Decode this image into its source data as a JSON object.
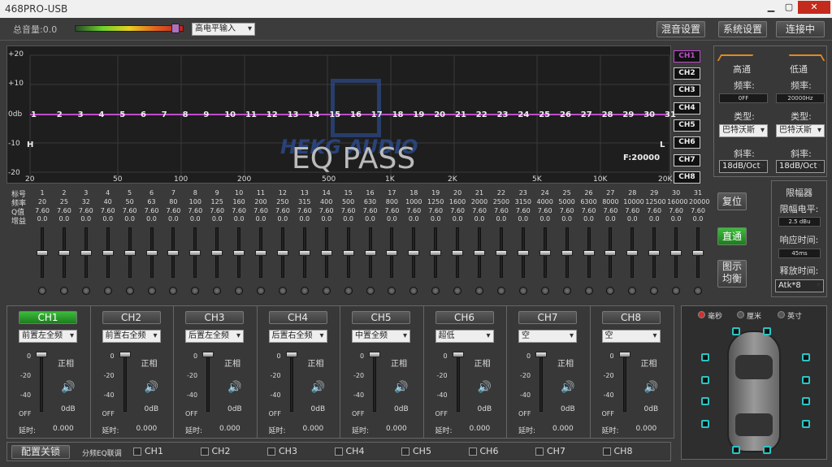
{
  "window": {
    "title": "468PRO-USB",
    "min": "▁",
    "max": "▢",
    "close": "✕"
  },
  "toolbar": {
    "master_volume": "总音量:0.0",
    "input_mode": "高电平输入",
    "mix_settings": "混音设置",
    "system_settings": "系统设置",
    "connect": "连接中"
  },
  "graph": {
    "y_labels": [
      "+20",
      "+10",
      "0db",
      "-10",
      "-20"
    ],
    "x_labels": [
      "20",
      "50",
      "100",
      "200",
      "500",
      "1K",
      "2K",
      "5K",
      "10K",
      "20K"
    ],
    "band_numbers": [
      "1",
      "2",
      "3",
      "4",
      "5",
      "6",
      "7",
      "8",
      "9",
      "10",
      "11",
      "12",
      "13",
      "14",
      "15",
      "16",
      "17",
      "18",
      "19",
      "20",
      "21",
      "22",
      "23",
      "24",
      "25",
      "26",
      "27",
      "28",
      "29",
      "30",
      "31"
    ],
    "h_mark": "H",
    "l_mark": "L",
    "freq_readout": "F:20000",
    "logo_text": "HEKG AUDIO",
    "eq_status": "EQ PASS",
    "channels": [
      "CH1",
      "CH2",
      "CH3",
      "CH4",
      "CH5",
      "CH6",
      "CH7",
      "CH8"
    ]
  },
  "eq": {
    "row_labels": [
      "标号",
      "频率",
      "Q值",
      "增益"
    ],
    "freqs": [
      "20",
      "25",
      "32",
      "40",
      "50",
      "63",
      "80",
      "100",
      "125",
      "160",
      "200",
      "250",
      "315",
      "400",
      "500",
      "630",
      "800",
      "1000",
      "1250",
      "1600",
      "2000",
      "2500",
      "3150",
      "4000",
      "5000",
      "6300",
      "8000",
      "10000",
      "12500",
      "16000",
      "20000"
    ],
    "q": "7.60",
    "gain": "0.0",
    "reset": "复位",
    "bypass": "直通",
    "show_eq": "图示\n均衡"
  },
  "crossover": {
    "hp": {
      "title": "高通",
      "freq_label": "频率:",
      "freq": "0FF",
      "type_label": "类型:",
      "type": "巴特沃斯",
      "slope_label": "斜率:",
      "slope": "18dB/Oct"
    },
    "lp": {
      "title": "低通",
      "freq_label": "频率:",
      "freq": "20000Hz",
      "type_label": "类型:",
      "type": "巴特沃斯",
      "slope_label": "斜率:",
      "slope": "18dB/Oct"
    }
  },
  "limiter": {
    "title": "限幅器",
    "level_label": "限幅电平:",
    "level": "2.5 dBu",
    "attack_label": "响应时间:",
    "attack": "45ms",
    "release_label": "释放时间:",
    "release": "Atk*8"
  },
  "channels": [
    {
      "name": "CH1",
      "pos": "前置左全频",
      "phase": "正相",
      "gain": "0dB",
      "delay_label": "延时:",
      "delay": "0.000"
    },
    {
      "name": "CH2",
      "pos": "前置右全频",
      "phase": "正相",
      "gain": "0dB",
      "delay_label": "延时:",
      "delay": "0.000"
    },
    {
      "name": "CH3",
      "pos": "后置左全频",
      "phase": "正相",
      "gain": "0dB",
      "delay_label": "延时:",
      "delay": "0.000"
    },
    {
      "name": "CH4",
      "pos": "后置右全频",
      "phase": "正相",
      "gain": "0dB",
      "delay_label": "延时:",
      "delay": "0.000"
    },
    {
      "name": "CH5",
      "pos": "中置全频",
      "phase": "正相",
      "gain": "0dB",
      "delay_label": "延时:",
      "delay": "0.000"
    },
    {
      "name": "CH6",
      "pos": "超低",
      "phase": "正相",
      "gain": "0dB",
      "delay_label": "延时:",
      "delay": "0.000"
    },
    {
      "name": "CH7",
      "pos": "空",
      "phase": "正相",
      "gain": "0dB",
      "delay_label": "延时:",
      "delay": "0.000"
    },
    {
      "name": "CH8",
      "pos": "空",
      "phase": "正相",
      "gain": "0dB",
      "delay_label": "延时:",
      "delay": "0.000"
    }
  ],
  "fader_scale": [
    "0",
    "-20",
    "-40",
    "OFF"
  ],
  "units": {
    "ms": "毫秒",
    "cm": "厘米",
    "inch": "英寸"
  },
  "bottom": {
    "config_lock": "配置关锁",
    "link_label": "分频EQ联调",
    "link_channels": [
      "CH1",
      "CH2",
      "CH3",
      "CH4",
      "CH5",
      "CH6",
      "CH7",
      "CH8"
    ]
  },
  "colors": {
    "eq_curve": "#c04ccc",
    "accent_green": "#2ea82e",
    "ch_select": "#c04ccc"
  }
}
